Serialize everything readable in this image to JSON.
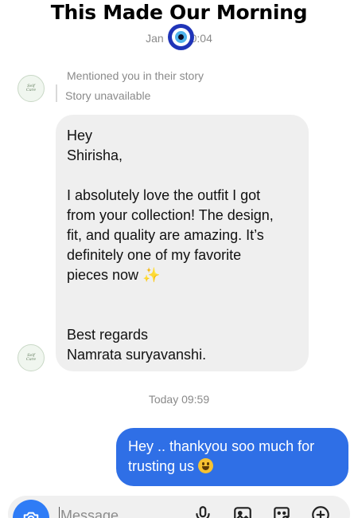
{
  "headline": "This Made Our Morning",
  "thread": {
    "timestamp_top_left": "Jan ",
    "timestamp_top_right": "0:04",
    "story_mention": {
      "note": "Mentioned you in their story",
      "status": "Story unavailable"
    },
    "avatar_text_line1": "Self",
    "avatar_text_line2": "Care",
    "incoming_message": {
      "lines": {
        "l1": "Hey",
        "l2": "Shirisha,",
        "l3": " I absolutely love the outfit I got",
        "l4": "from your collection! The design,",
        "l5": "fit, and quality are amazing. It’s",
        "l6": "definitely one of my favorite",
        "l7": "pieces now ",
        "l8": "Best regards",
        "l9": "Namrata suryavanshi."
      },
      "emoji": "✨"
    },
    "timestamp_today": "Today 09:59",
    "outgoing_message": {
      "line1": "Hey .. thankyou soo much for",
      "line2": "trusting us "
    }
  },
  "composer": {
    "placeholder": "Message..."
  },
  "colors": {
    "outgoing_bubble": "#2f6fe6",
    "incoming_bubble": "#efefef",
    "camera_button": "#2f7cf6",
    "evil_eye": "#1f34b8"
  },
  "icons": [
    "evil-eye-icon",
    "camera-icon",
    "microphone-icon",
    "gallery-icon",
    "sticker-icon",
    "plus-circle-icon"
  ]
}
